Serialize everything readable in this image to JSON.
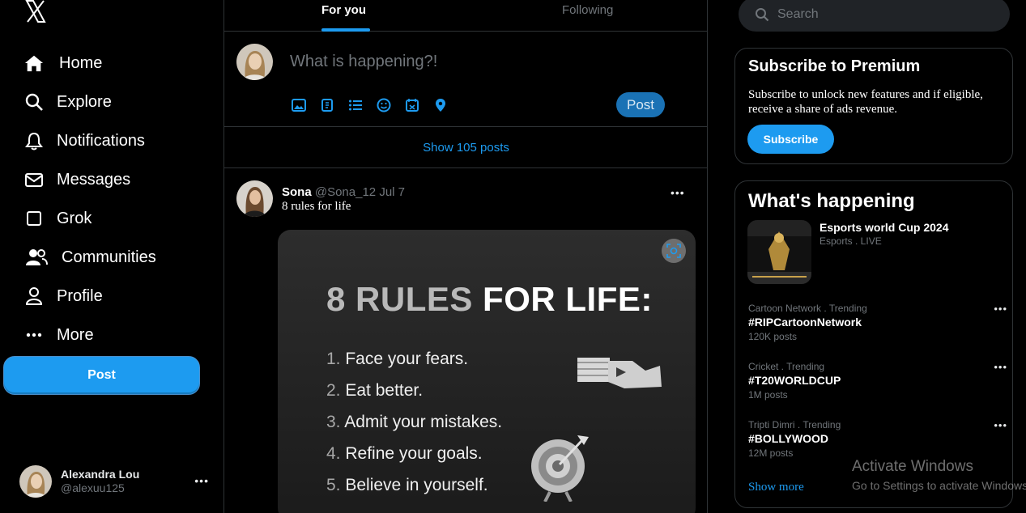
{
  "nav": {
    "logo_icon": "x-logo-icon",
    "items": [
      {
        "label": "Home",
        "icon": "home-icon"
      },
      {
        "label": "Explore",
        "icon": "search-icon"
      },
      {
        "label": "Notifications",
        "icon": "bell-icon"
      },
      {
        "label": "Messages",
        "icon": "envelope-icon"
      },
      {
        "label": "Grok",
        "icon": "grok-icon"
      },
      {
        "label": "Communities",
        "icon": "people-icon"
      },
      {
        "label": "Profile",
        "icon": "person-icon"
      },
      {
        "label": "More",
        "icon": "more-icon"
      }
    ],
    "post_label": "Post"
  },
  "account": {
    "name": "Alexandra Lou",
    "handle": "@alexuu125",
    "menu": "•••"
  },
  "tabs": {
    "for_you": "For you",
    "following": "Following"
  },
  "composer": {
    "placeholder": "What is happening?!",
    "tools": [
      "image-icon",
      "gif-icon",
      "poll-icon",
      "emoji-icon",
      "schedule-icon",
      "location-icon"
    ],
    "post_label": "Post"
  },
  "feed": {
    "show_posts": "Show 105 posts",
    "tweet": {
      "name": "Sona",
      "handle_date": "@Sona_12 Jul 7",
      "text": "8 rules for life",
      "menu": "•••",
      "image": {
        "headline_a": "8 RULES",
        "headline_b": "FOR LIFE:",
        "rules": [
          {
            "num": "1.",
            "text": "Face your fears."
          },
          {
            "num": "2.",
            "text": "Eat better."
          },
          {
            "num": "3.",
            "text": "Admit your mistakes."
          },
          {
            "num": "4.",
            "text": "Refine your goals."
          },
          {
            "num": "5.",
            "text": "Believe in yourself."
          }
        ]
      }
    }
  },
  "search": {
    "placeholder": "Search"
  },
  "premium": {
    "title": "Subscribe to Premium",
    "desc": "Subscribe to unlock new features and if eligible, receive a share of ads revenue.",
    "button": "Subscribe"
  },
  "happening": {
    "title": "What's happening",
    "event": {
      "title": "Esports world Cup 2024",
      "sub": "Esports . LIVE"
    },
    "trends": [
      {
        "category": "Cartoon Network . Trending",
        "tag": "#RIPCartoonNetwork",
        "count": "120K posts"
      },
      {
        "category": "Cricket . Trending",
        "tag": "#T20WORLDCUP",
        "count": "1M posts"
      },
      {
        "category": "Tripti Dimri . Trending",
        "tag": "#BOLLYWOOD",
        "count": "12M posts"
      }
    ],
    "trend_menu": "•••",
    "show_more": "Show more"
  },
  "watermark": {
    "line1": "Activate Windows",
    "line2": "Go to Settings to activate Windows."
  }
}
